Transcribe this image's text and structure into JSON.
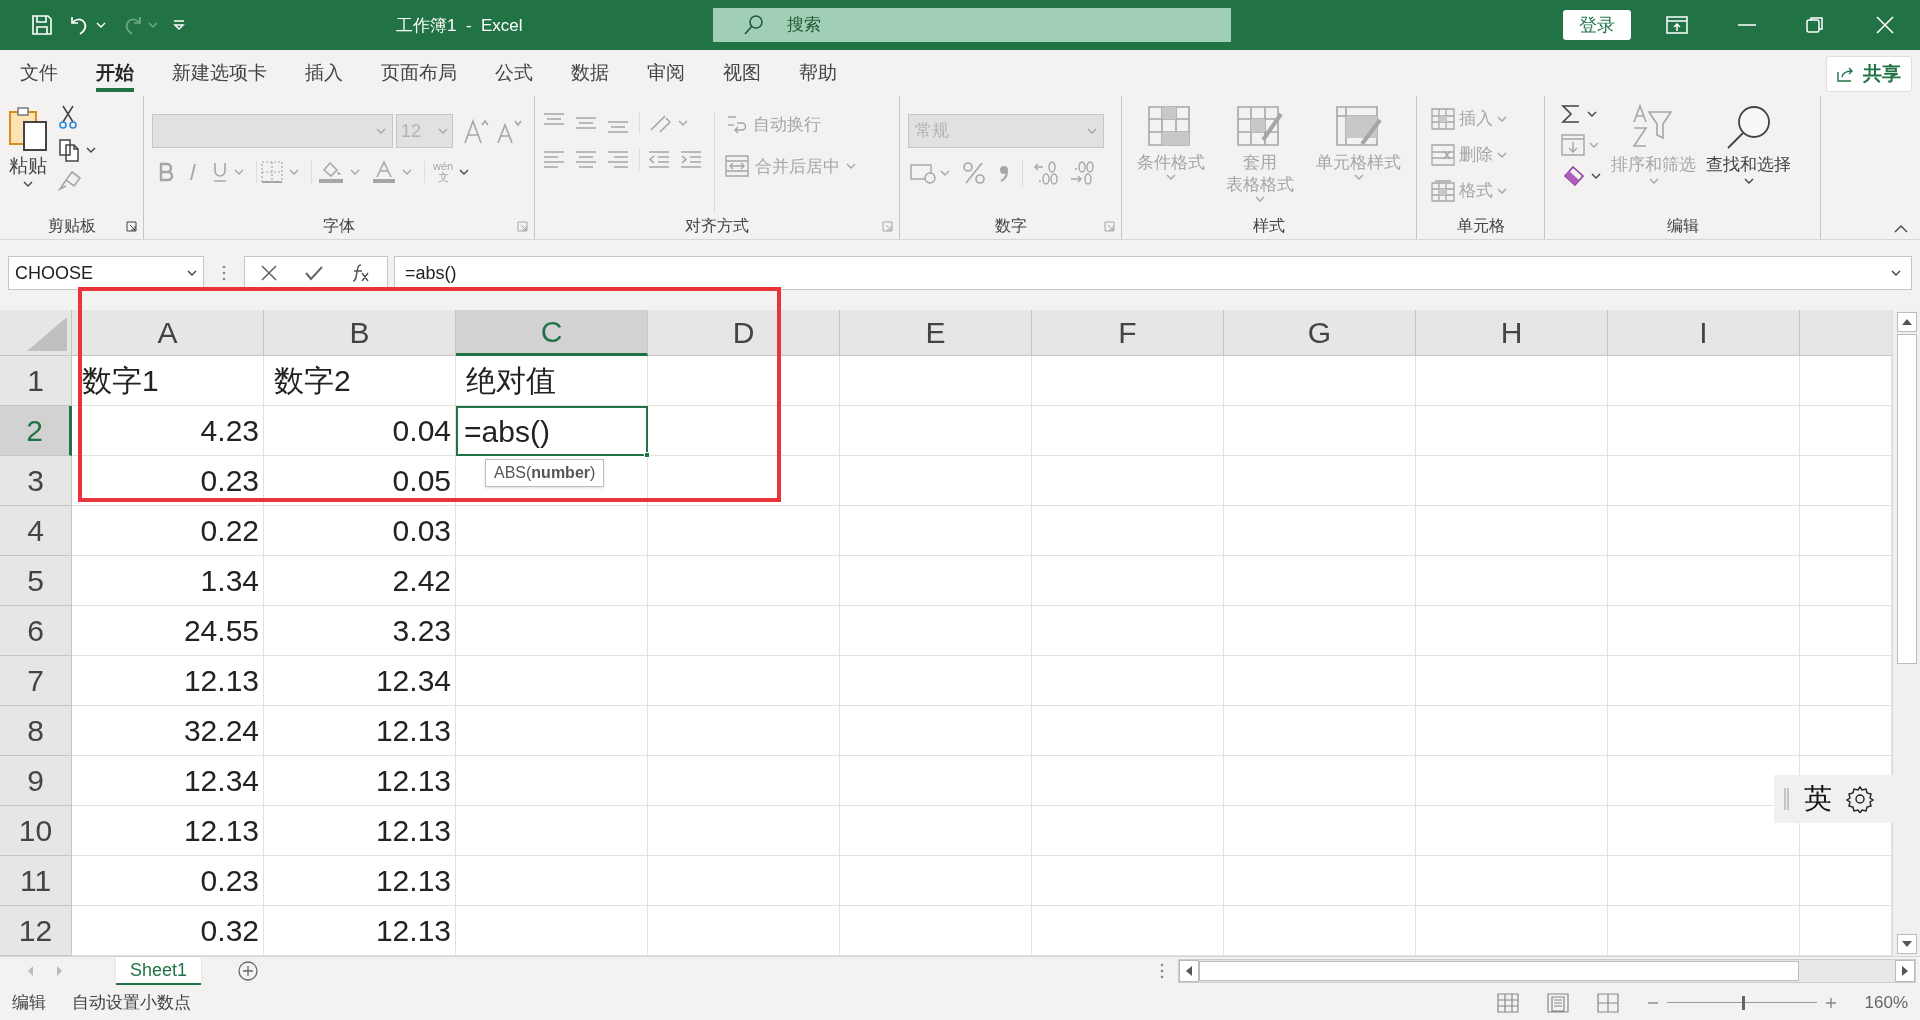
{
  "title_bar": {
    "title": "工作簿1  -  Excel",
    "search": {
      "placeholder": "搜索"
    },
    "sign_in": "登录"
  },
  "menu_tabs": [
    {
      "label": "文件",
      "selected": false
    },
    {
      "label": "开始",
      "selected": true
    },
    {
      "label": "新建选项卡",
      "selected": false
    },
    {
      "label": "插入",
      "selected": false
    },
    {
      "label": "页面布局",
      "selected": false
    },
    {
      "label": "公式",
      "selected": false
    },
    {
      "label": "数据",
      "selected": false
    },
    {
      "label": "审阅",
      "selected": false
    },
    {
      "label": "视图",
      "selected": false
    },
    {
      "label": "帮助",
      "selected": false
    }
  ],
  "share_button": "共享",
  "ribbon": {
    "groups": [
      {
        "label": "剪贴板",
        "commands": [
          {
            "label": "粘贴",
            "disabled": false
          }
        ]
      },
      {
        "label": "字体",
        "font_size": {
          "value": "12",
          "disabled": true
        },
        "phonetic_guide": {
          "top": "wén",
          "bottom": "文"
        }
      },
      {
        "label": "对齐方式",
        "commands": [
          {
            "label": "自动换行",
            "disabled": true
          },
          {
            "label": "合并后居中",
            "disabled": true
          }
        ]
      },
      {
        "label": "数字",
        "number_format": {
          "value": "常规",
          "disabled": true
        }
      },
      {
        "label": "样式",
        "commands": [
          {
            "label": "条件格式",
            "disabled": true
          },
          {
            "label_lines": [
              "套用",
              "表格格式"
            ],
            "disabled": true
          },
          {
            "label": "单元格样式",
            "disabled": true
          }
        ]
      },
      {
        "label": "单元格",
        "commands": [
          {
            "label": "插入",
            "disabled": true
          },
          {
            "label": "删除",
            "disabled": true
          },
          {
            "label": "格式",
            "disabled": true
          }
        ]
      },
      {
        "label": "编辑",
        "commands": [
          {
            "label": "排序和筛选",
            "disabled": true
          },
          {
            "label": "查找和选择",
            "disabled": false
          }
        ]
      }
    ]
  },
  "formula_bar": {
    "name_box": "CHOOSE",
    "formula": "=abs()"
  },
  "sheet": {
    "columns": [
      {
        "label": "A",
        "selected": false
      },
      {
        "label": "B",
        "selected": false
      },
      {
        "label": "C",
        "selected": true
      },
      {
        "label": "D",
        "selected": false
      },
      {
        "label": "E",
        "selected": false
      },
      {
        "label": "F",
        "selected": false
      },
      {
        "label": "G",
        "selected": false
      },
      {
        "label": "H",
        "selected": false
      },
      {
        "label": "I",
        "selected": false
      }
    ],
    "rows": [
      {
        "label": "1",
        "selected": false,
        "cells": [
          {
            "value": "数字1",
            "kind": "text"
          },
          {
            "value": "数字2",
            "kind": "text"
          },
          {
            "value": "绝对值",
            "kind": "text"
          }
        ]
      },
      {
        "label": "2",
        "selected": true,
        "cells": [
          {
            "value": "4.23",
            "kind": "number"
          },
          {
            "value": "0.04",
            "kind": "number"
          },
          {
            "value": "=abs()",
            "kind": "editing"
          }
        ]
      },
      {
        "label": "3",
        "selected": false,
        "cells": [
          {
            "value": "0.23",
            "kind": "number"
          },
          {
            "value": "0.05",
            "kind": "number"
          }
        ]
      },
      {
        "label": "4",
        "selected": false,
        "cells": [
          {
            "value": "0.22",
            "kind": "number"
          },
          {
            "value": "0.03",
            "kind": "number"
          }
        ]
      },
      {
        "label": "5",
        "selected": false,
        "cells": [
          {
            "value": "1.34",
            "kind": "number"
          },
          {
            "value": "2.42",
            "kind": "number"
          }
        ]
      },
      {
        "label": "6",
        "selected": false,
        "cells": [
          {
            "value": "24.55",
            "kind": "number"
          },
          {
            "value": "3.23",
            "kind": "number"
          }
        ]
      },
      {
        "label": "7",
        "selected": false,
        "cells": [
          {
            "value": "12.13",
            "kind": "number"
          },
          {
            "value": "12.34",
            "kind": "number"
          }
        ]
      },
      {
        "label": "8",
        "selected": false,
        "cells": [
          {
            "value": "32.24",
            "kind": "number"
          },
          {
            "value": "12.13",
            "kind": "number"
          }
        ]
      },
      {
        "label": "9",
        "selected": false,
        "cells": [
          {
            "value": "12.34",
            "kind": "number"
          },
          {
            "value": "12.13",
            "kind": "number"
          }
        ]
      },
      {
        "label": "10",
        "selected": false,
        "cells": [
          {
            "value": "12.13",
            "kind": "number"
          },
          {
            "value": "12.13",
            "kind": "number"
          }
        ]
      },
      {
        "label": "11",
        "selected": false,
        "cells": [
          {
            "value": "0.23",
            "kind": "number"
          },
          {
            "value": "12.13",
            "kind": "number"
          }
        ]
      },
      {
        "label": "12",
        "selected": false,
        "cells": [
          {
            "value": "0.32",
            "kind": "number"
          },
          {
            "value": "12.13",
            "kind": "number"
          }
        ]
      }
    ]
  },
  "function_tooltip": "ABS(**number**)",
  "annotations": [
    {
      "kind": "rectangle"
    }
  ],
  "sheet_tabs": [
    {
      "label": "Sheet1",
      "selected": true
    }
  ],
  "status_bar": {
    "mode": "编辑",
    "fixed_decimal": "自动设置小数点",
    "zoom": {
      "value": "160%",
      "level": 0.5
    }
  },
  "ime_bar": {
    "language": "英"
  }
}
